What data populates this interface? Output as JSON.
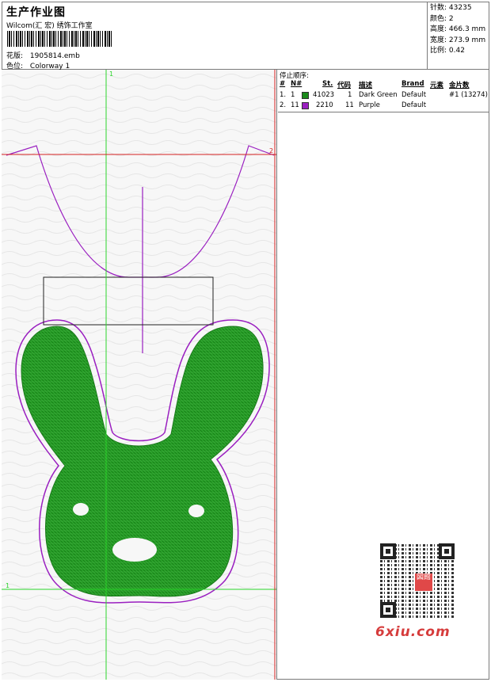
{
  "header": {
    "title": "生产作业图",
    "subtitle": "Wilcom(汇 宏) 绣饰工作室",
    "design_file_label": "花版:",
    "design_file": "1905814.emb",
    "colorway_label": "色位:",
    "colorway": "Colorway 1"
  },
  "stats": [
    {
      "label": "针数:",
      "value": "43235"
    },
    {
      "label": "颜色:",
      "value": "2"
    },
    {
      "label": "高度:",
      "value": "466.3 mm"
    },
    {
      "label": "宽度:",
      "value": "273.9 mm"
    },
    {
      "label": "比例:",
      "value": "0.42"
    }
  ],
  "legend": {
    "stop_sequence_label": "停止顺序:",
    "columns": [
      "#",
      "N#",
      "St.",
      "代码",
      "描述",
      "Brand",
      "元素",
      "金片数"
    ],
    "rows": [
      {
        "idx": "1.",
        "n": "1",
        "color": "#1a8a1a",
        "stitches": "41023",
        "code": "1",
        "desc": "Dark Green",
        "brand": "Default",
        "element": "",
        "sequins": "#1 (13274)"
      },
      {
        "idx": "2.",
        "n": "11",
        "color": "#9a1fc0",
        "stitches": "2210",
        "code": "11",
        "desc": "Purple",
        "brand": "Default",
        "element": "",
        "sequins": ""
      }
    ]
  },
  "design": {
    "marker_top": "1",
    "marker_right": "2",
    "marker_left": "1",
    "guide_color_v": "#2bd62b",
    "guide_color_h": "#d42020",
    "fill_color": "#1f9a1f",
    "outline_color": "#9a1fc0"
  },
  "watermark": {
    "stamp": "図館",
    "site": "6xiu.com"
  }
}
